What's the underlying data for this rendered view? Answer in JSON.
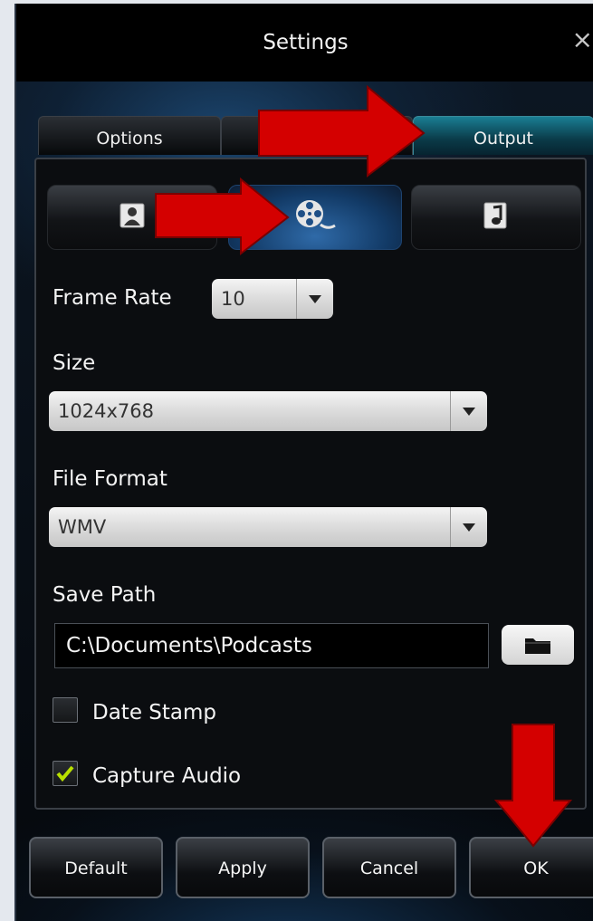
{
  "window": {
    "title": "Settings",
    "close_glyph": "×"
  },
  "tabs": [
    {
      "label": "Options",
      "active": false
    },
    {
      "label": "",
      "active": false
    },
    {
      "label": "Output",
      "active": true
    }
  ],
  "subtabs": [
    {
      "icon": "person-icon",
      "active": false
    },
    {
      "icon": "film-reel-icon",
      "active": true
    },
    {
      "icon": "music-note-icon",
      "active": false
    }
  ],
  "frame_rate": {
    "label": "Frame Rate",
    "value": "10"
  },
  "size": {
    "label": "Size",
    "value": "1024x768"
  },
  "file_format": {
    "label": "File Format",
    "value": "WMV"
  },
  "save_path": {
    "label": "Save Path",
    "value": "C:\\Documents\\Podcasts"
  },
  "date_stamp": {
    "label": "Date Stamp",
    "checked": false
  },
  "capture_audio": {
    "label": "Capture Audio",
    "checked": true
  },
  "buttons": {
    "default": "Default",
    "apply": "Apply",
    "cancel": "Cancel",
    "ok": "OK"
  },
  "colors": {
    "accent_tab": "#1a7e93",
    "active_subtab": "#2f6aa8",
    "check_mark": "#b8e000",
    "annotation_arrow": "#d40000"
  }
}
